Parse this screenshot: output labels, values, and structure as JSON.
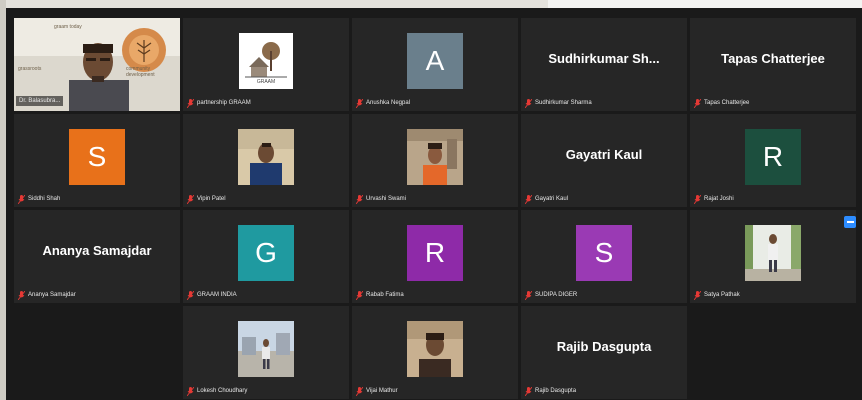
{
  "colors": {
    "active_speaker_border": "#b8d24a",
    "tile_bg": "#262626",
    "screen_bg": "#1a1a1a",
    "button_blue": "#2d8cff"
  },
  "participants": [
    {
      "name": "Dr. Balasubra...",
      "kind": "video-host",
      "muted": false,
      "active": true,
      "banner_top": "graam today",
      "banner_mid": "grassroots",
      "banner_right": "community development"
    },
    {
      "name": "partnership GRAAM",
      "kind": "logo",
      "muted": true,
      "logo_text": "GRAAM"
    },
    {
      "name": "Anushka Negpal",
      "kind": "avatar",
      "initial": "A",
      "color": "#6a7f8c",
      "muted": true
    },
    {
      "name": "Sudhirkumar Sharma",
      "kind": "text",
      "display": "Sudhirkumar Sh...",
      "muted": true
    },
    {
      "name": "Tapas Chatterjee",
      "kind": "text",
      "display": "Tapas Chatterjee",
      "muted": true
    },
    {
      "name": "Siddhi Shah",
      "kind": "avatar",
      "initial": "S",
      "color": "#e8711a",
      "muted": true
    },
    {
      "name": "Vipin Patel",
      "kind": "photo",
      "muted": true
    },
    {
      "name": "Urvashi Swami",
      "kind": "photo",
      "muted": true
    },
    {
      "name": "Gayatri Kaul",
      "kind": "text",
      "display": "Gayatri Kaul",
      "muted": true
    },
    {
      "name": "Rajat Joshi",
      "kind": "avatar",
      "initial": "R",
      "color": "#1c4f3e",
      "muted": true
    },
    {
      "name": "Ananya Samajdar",
      "kind": "text",
      "display": "Ananya Samajdar",
      "muted": true
    },
    {
      "name": "GRAAM INDIA",
      "kind": "avatar",
      "initial": "G",
      "color": "#1f9aa0",
      "muted": true
    },
    {
      "name": "Rabab Fatima",
      "kind": "avatar",
      "initial": "R",
      "color": "#8e2aa8",
      "muted": true
    },
    {
      "name": "SUDIPA DIGER",
      "kind": "avatar",
      "initial": "S",
      "color": "#9a3ab4",
      "muted": true
    },
    {
      "name": "Satya Pathak",
      "kind": "photo",
      "muted": true
    },
    {
      "name": "",
      "kind": "empty"
    },
    {
      "name": "Lokesh Choudhary",
      "kind": "photo",
      "muted": true
    },
    {
      "name": "Vijai Mathur",
      "kind": "photo",
      "muted": true
    },
    {
      "name": "Rajib Dasgupta",
      "kind": "text",
      "display": "Rajib Dasgupta",
      "muted": true
    },
    {
      "name": "",
      "kind": "empty"
    }
  ]
}
